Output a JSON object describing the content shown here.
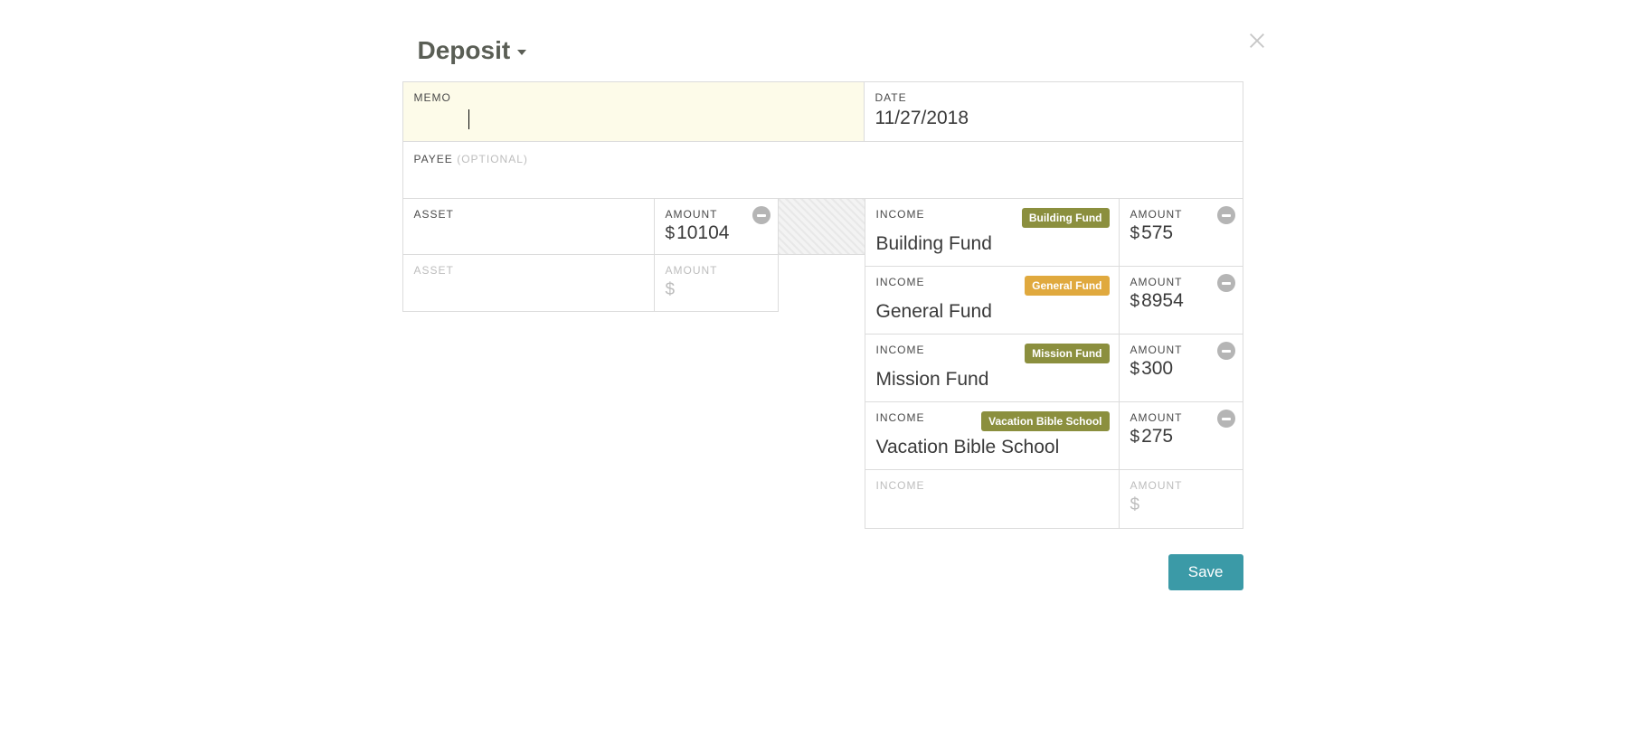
{
  "title": "Deposit",
  "labels": {
    "memo": "MEMO",
    "date": "DATE",
    "payee": "PAYEE",
    "payee_optional": "(OPTIONAL)",
    "asset": "ASSET",
    "amount": "AMOUNT",
    "income": "INCOME"
  },
  "date_value": "11/27/2018",
  "assets": [
    {
      "name": "",
      "amount": "10104"
    }
  ],
  "incomes": [
    {
      "category": "Building Fund",
      "tag": "Building Fund",
      "tag_color": "#8b8f3e",
      "amount": "575"
    },
    {
      "category": "General Fund",
      "tag": "General Fund",
      "tag_color": "#e0a93e",
      "amount": "8954"
    },
    {
      "category": "Mission Fund",
      "tag": "Mission Fund",
      "tag_color": "#8b8f3e",
      "amount": "300"
    },
    {
      "category": "Vacation Bible School",
      "tag": "Vacation Bible School",
      "tag_color": "#8b8f3e",
      "amount": "275"
    }
  ],
  "currency_symbol": "$",
  "save_label": "Save"
}
